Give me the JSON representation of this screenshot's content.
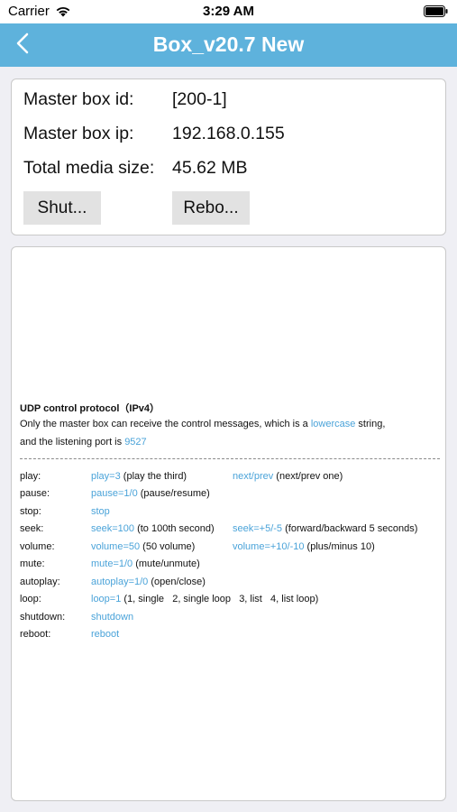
{
  "status_bar": {
    "carrier": "Carrier",
    "time": "3:29 AM"
  },
  "nav": {
    "title": "Box_v20.7 New",
    "back_icon": "chevron-left-icon"
  },
  "info": {
    "master_box_id_label": "Master box id:",
    "master_box_id_value": "[200-1]",
    "master_box_ip_label": "Master box ip:",
    "master_box_ip_value": "192.168.0.155",
    "total_media_size_label": "Total media size:",
    "total_media_size_value": "45.62 MB",
    "shutdown_button": "Shut...",
    "reboot_button": "Rebo..."
  },
  "protocol": {
    "heading": "UDP control protocol（IPv4）",
    "desc_line1_pre": "Only the master box can receive the control messages, which is a ",
    "desc_line1_link": "lowercase",
    "desc_line1_post": " string,",
    "desc_line2_pre": "and the listening port is ",
    "desc_line2_link": "9527",
    "commands": [
      {
        "key": "play:",
        "cmd1": "play=3",
        "note1": " (play the third)",
        "cmd2": "next/prev",
        "note2": " (next/prev one)"
      },
      {
        "key": "pause:",
        "cmd1": "pause=1/0",
        "note1": " (pause/resume)",
        "cmd2": "",
        "note2": ""
      },
      {
        "key": "stop:",
        "cmd1": "stop",
        "note1": "",
        "cmd2": "",
        "note2": ""
      },
      {
        "key": "seek:",
        "cmd1": "seek=100",
        "note1": " (to 100th second)",
        "cmd2": "seek=+5/-5",
        "note2": " (forward/backward 5 seconds)"
      },
      {
        "key": "volume:",
        "cmd1": "volume=50",
        "note1": " (50 volume)",
        "cmd2": "volume=+10/-10",
        "note2": " (plus/minus 10)"
      },
      {
        "key": "mute:",
        "cmd1": "mute=1/0",
        "note1": " (mute/unmute)",
        "cmd2": "",
        "note2": ""
      },
      {
        "key": "autoplay:",
        "cmd1": "autoplay=1/0",
        "note1": " (open/close)",
        "cmd2": "",
        "note2": ""
      },
      {
        "key": "loop:",
        "cmd1": "loop=1",
        "note1": " (1, single   2, single loop   3, list   4, list loop)",
        "cmd2": "",
        "note2": ""
      },
      {
        "key": "shutdown:",
        "cmd1": "shutdown",
        "note1": "",
        "cmd2": "",
        "note2": ""
      },
      {
        "key": "reboot:",
        "cmd1": "reboot",
        "note1": "",
        "cmd2": "",
        "note2": ""
      }
    ]
  },
  "colors": {
    "nav_bg": "#5eb2dc",
    "link": "#4aa3d9",
    "button_bg": "#e2e2e2"
  }
}
